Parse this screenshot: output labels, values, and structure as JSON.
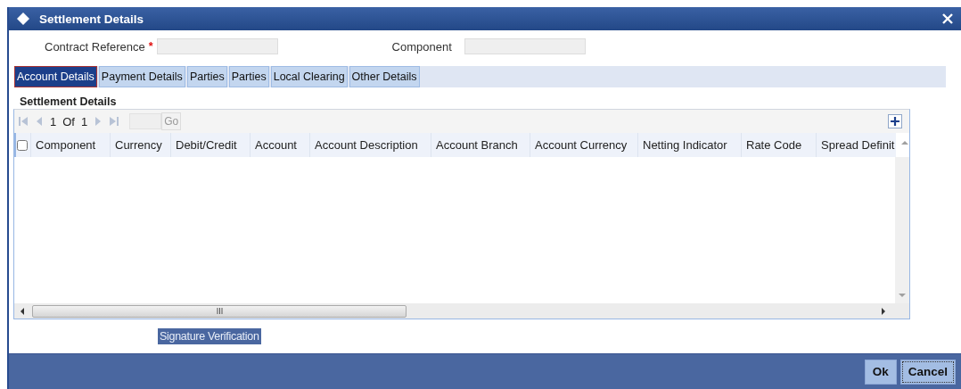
{
  "window": {
    "title": "Settlement Details"
  },
  "fields": [
    {
      "label": "Contract Reference",
      "required": true,
      "value_mark": "*"
    },
    {
      "label": "Component",
      "required": false
    }
  ],
  "tabs": [
    {
      "label": "Account Details",
      "selected": true
    },
    {
      "label": "Payment Details",
      "selected": false
    },
    {
      "label": "Parties",
      "selected": false
    },
    {
      "label": "Parties",
      "selected": false
    },
    {
      "label": "Local Clearing",
      "selected": false
    },
    {
      "label": "Other Details",
      "selected": false
    }
  ],
  "section": {
    "title": "Settlement Details"
  },
  "pager": {
    "current": "1",
    "of": "Of",
    "total": "1",
    "go": "Go"
  },
  "table": {
    "select_all": {
      "checked": false
    },
    "columns": [
      "Component",
      "Currency",
      "Debit/Credit",
      "Account",
      "Account Description",
      "Account Branch",
      "Account Currency",
      "Netting Indicator",
      "Rate Code",
      "Spread Definit"
    ]
  },
  "signature_button": "Signature Verification",
  "buttons": [
    {
      "label": "Ok",
      "focused": false
    },
    {
      "label": "Cancel",
      "focused": true
    }
  ]
}
